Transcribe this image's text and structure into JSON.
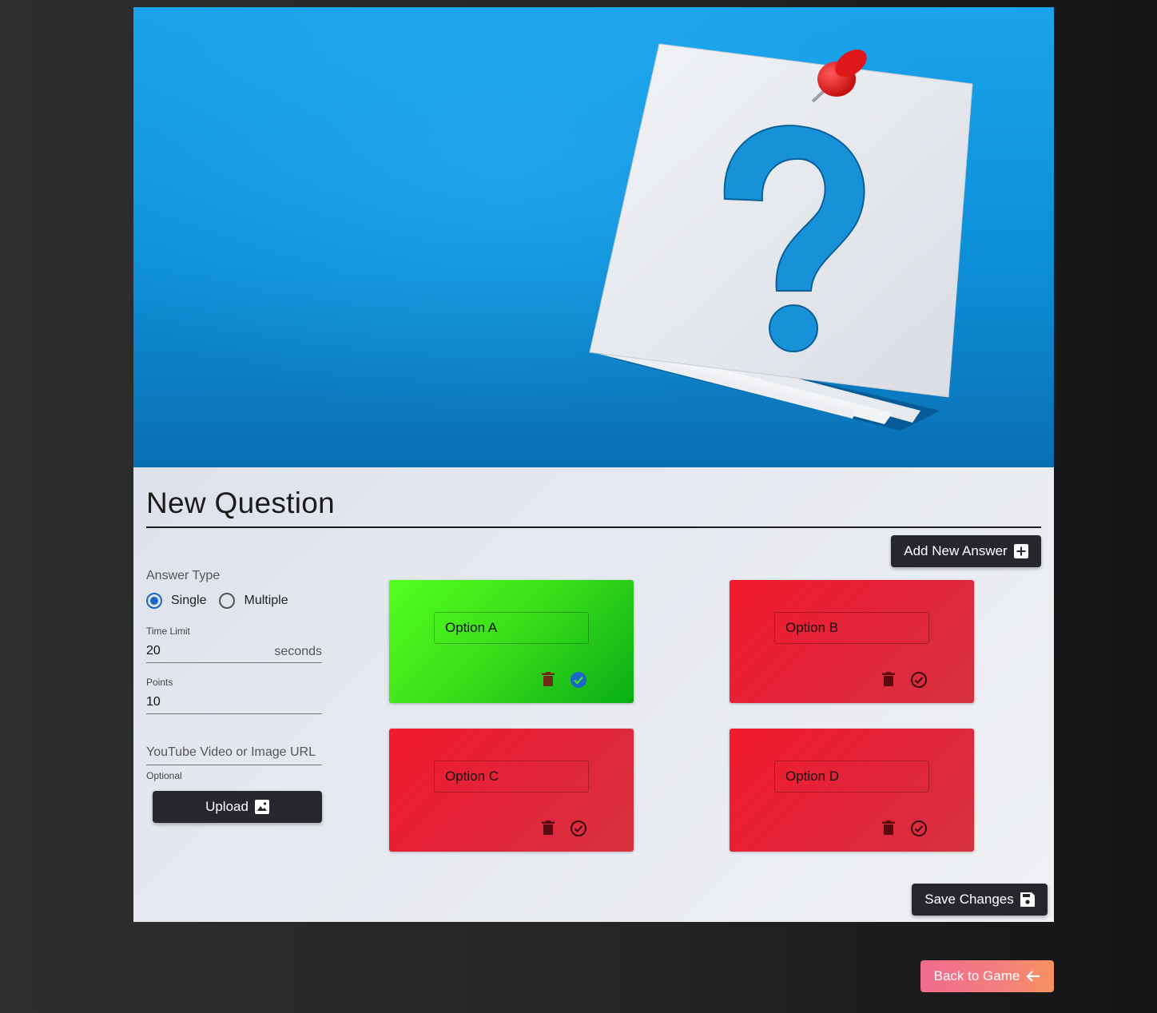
{
  "hero": {
    "image_description_icon": "question-mark-note-pinned-icon"
  },
  "page": {
    "title": "New Question"
  },
  "add_answer": {
    "label": "Add New Answer",
    "icon": "plus-box-icon"
  },
  "answer_type": {
    "label": "Answer Type",
    "options": [
      {
        "label": "Single",
        "checked": true
      },
      {
        "label": "Multiple",
        "checked": false
      }
    ]
  },
  "time_limit": {
    "label": "Time Limit",
    "value": "20",
    "unit": "seconds"
  },
  "points": {
    "label": "Points",
    "value": "10"
  },
  "media": {
    "placeholder": "YouTube Video or Image URL",
    "helper": "Optional"
  },
  "upload": {
    "label": "Upload",
    "icon": "image-icon"
  },
  "answers": [
    {
      "value": "Option A",
      "correct": true,
      "color": "#3ee01a"
    },
    {
      "value": "Option B",
      "correct": false,
      "color": "#e0243a"
    },
    {
      "value": "Option C",
      "correct": false,
      "color": "#e0243a"
    },
    {
      "value": "Option D",
      "correct": false,
      "color": "#e0243a"
    }
  ],
  "save": {
    "label": "Save Changes",
    "icon": "floppy-disk-icon"
  },
  "back": {
    "label": "Back to Game",
    "icon": "arrow-left-icon"
  },
  "colors": {
    "accent": "#1a66c9",
    "dark_button": "#26272d",
    "correct": "#3ee01a",
    "incorrect": "#e0243a"
  }
}
